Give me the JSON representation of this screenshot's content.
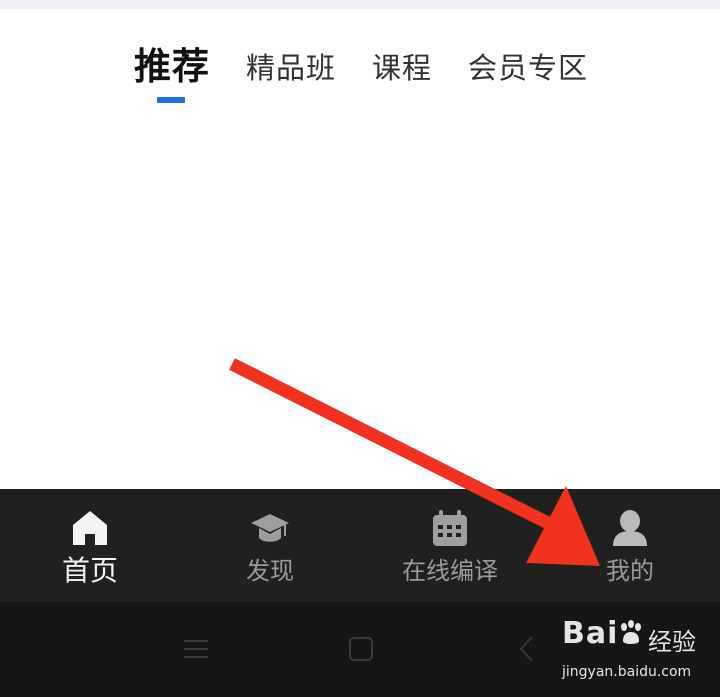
{
  "top_tabs": {
    "items": [
      {
        "label": "推荐",
        "active": true
      },
      {
        "label": "精品班",
        "active": false
      },
      {
        "label": "课程",
        "active": false
      },
      {
        "label": "会员专区",
        "active": false
      }
    ],
    "indicator_color": "#1f6fe0"
  },
  "bottom_nav": {
    "items": [
      {
        "label": "首页",
        "icon": "home-icon",
        "active": true
      },
      {
        "label": "发现",
        "icon": "graduation-cap-icon",
        "active": false
      },
      {
        "label": "在线编译",
        "icon": "calendar-icon",
        "active": false
      },
      {
        "label": "我的",
        "icon": "user-icon",
        "active": false
      }
    ],
    "background": "#202020"
  },
  "system_nav": {
    "buttons": [
      "menu-icon",
      "home-square-icon",
      "back-icon"
    ]
  },
  "watermark": {
    "brand": "Bai",
    "brand_cn": "经验",
    "url": "jingyan.baidu.com"
  },
  "annotation": {
    "arrow_color": "#f0321e",
    "points_to": "我的"
  }
}
